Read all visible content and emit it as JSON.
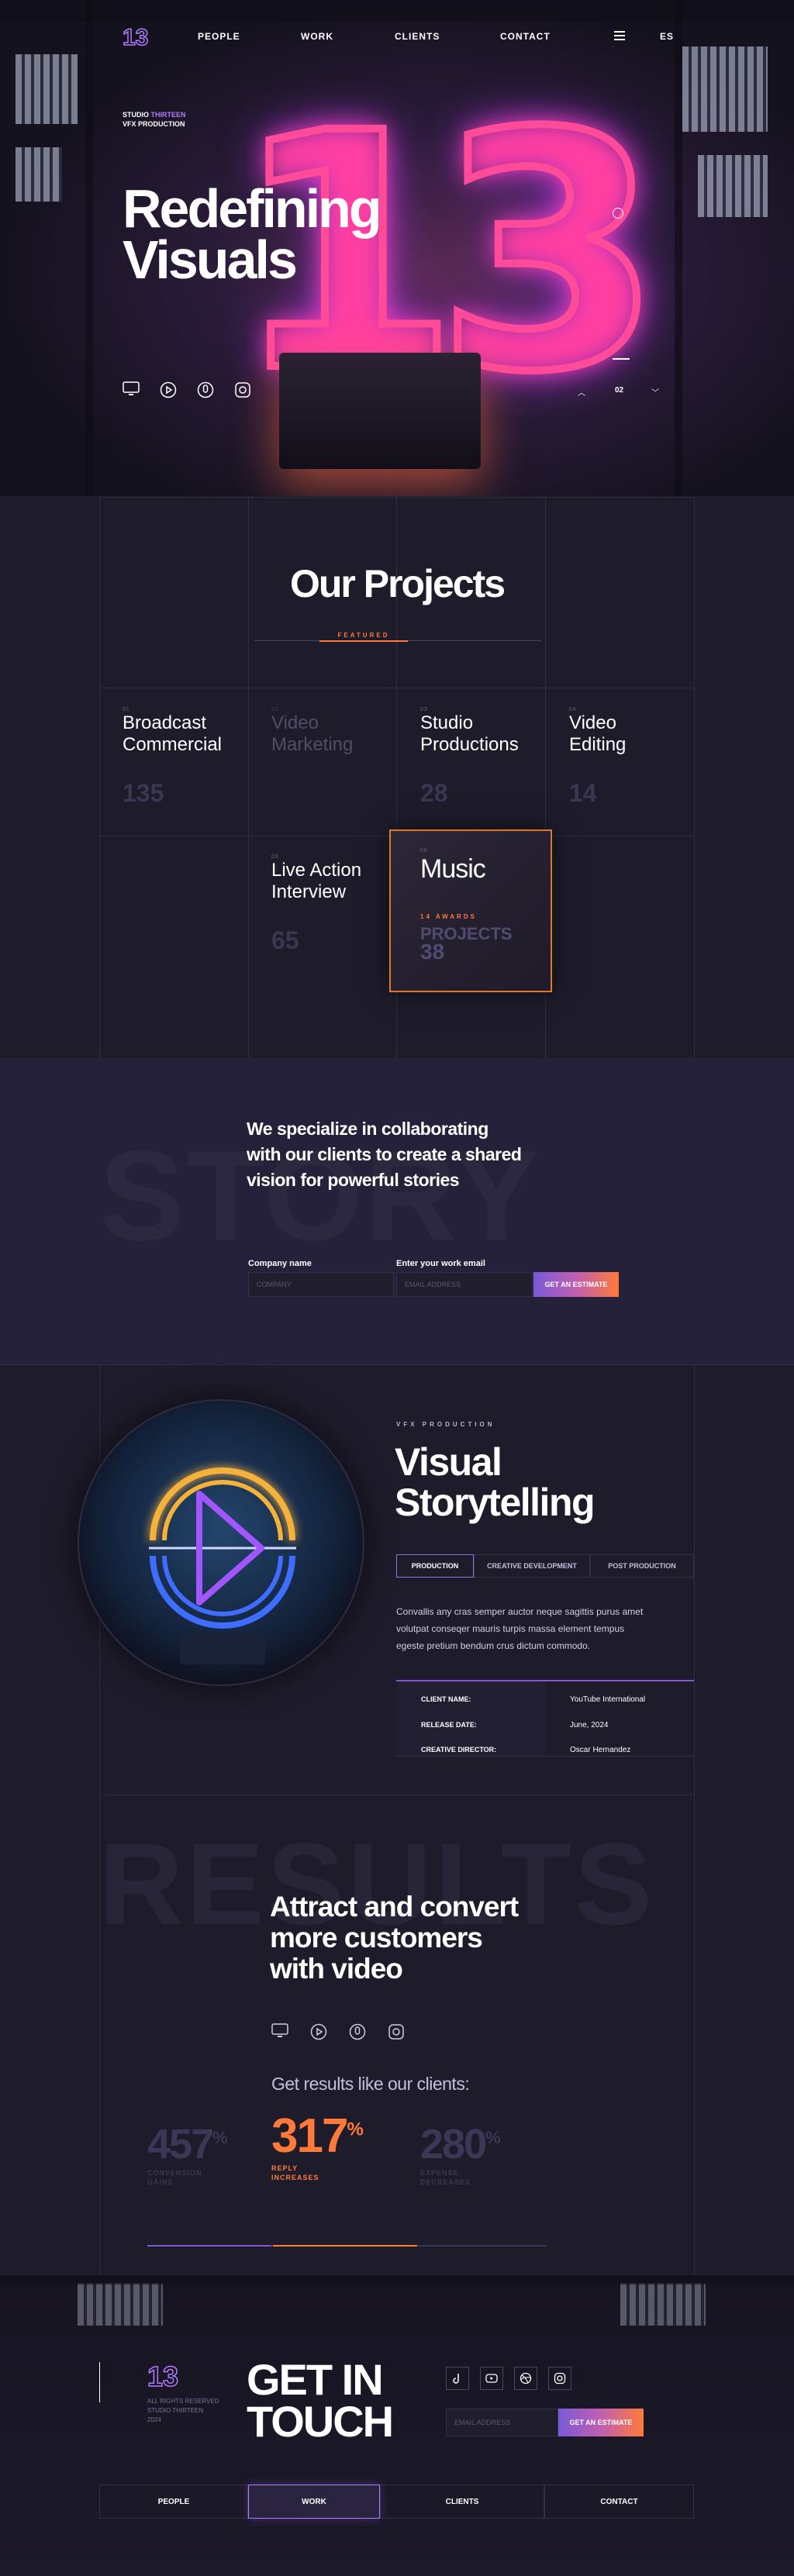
{
  "hero": {
    "logo": "13",
    "nav": [
      "PEOPLE",
      "WORK",
      "CLIENTS",
      "CONTACT"
    ],
    "lang": "ES",
    "studio_line1": "STUDIO",
    "studio_line1_accent": "THIRTEEN",
    "studio_line2": "VFX PRODUCTION",
    "title_line1": "Redefining",
    "title_line2": "Visuals",
    "slide": "02",
    "icons": [
      "monitor-icon",
      "play-icon",
      "mic-icon",
      "instagram-icon"
    ]
  },
  "projects": {
    "title": "Our Projects",
    "tab_label": "FEATURED",
    "items": [
      {
        "num": "01",
        "title_a": "Broadcast",
        "title_b": "Commercial",
        "count": "135"
      },
      {
        "num": "02",
        "title_a": "Video",
        "title_b": "Marketing",
        "count": ""
      },
      {
        "num": "03",
        "title_a": "Studio",
        "title_b": "Productions",
        "count": "28"
      },
      {
        "num": "04",
        "title_a": "Video",
        "title_b": "Editing",
        "count": "14"
      },
      {
        "num": "05",
        "title_a": "Live Action",
        "title_b": "Interview",
        "count": "65"
      }
    ],
    "featured": {
      "num": "06",
      "title": "Music",
      "awards": "14 AWARDS",
      "projects_label": "PROJECTS",
      "projects": "38"
    }
  },
  "story": {
    "ghost": "STORY",
    "headline_1": "We specialize in collaborating",
    "headline_2": "with our clients to create a shared",
    "headline_3": "vision for powerful stories",
    "company_label": "Company name",
    "company_placeholder": "COMPANY",
    "email_label": "Enter your work email",
    "email_placeholder": "EMAIL ADDRESS",
    "cta": "GET AN ESTIMATE"
  },
  "visual": {
    "kicker": "VFX PRODUCTION",
    "title_1": "Visual",
    "title_2": "Storytelling",
    "tabs": [
      "PRODUCTION",
      "CREATIVE DEVELOPMENT",
      "POST PRODUCTION"
    ],
    "body_1": "Convallis any cras semper auctor neque sagittis purus amet",
    "body_2": "volutpat conseqer mauris turpis massa element tempus",
    "body_3": "egeste pretium bendum crus dictum commodo.",
    "rows": [
      {
        "k": "CLIENT NAME:",
        "v": "YouTube International"
      },
      {
        "k": "RELEASE DATE:",
        "v": "June, 2024"
      },
      {
        "k": "CREATIVE DIRECTOR:",
        "v": "Oscar Hernandez"
      }
    ]
  },
  "results": {
    "ghost": "RESULTS",
    "headline_1": "Attract and convert",
    "headline_2": "more customers",
    "headline_3": "with video",
    "sub": "Get results like our clients:",
    "stats": [
      {
        "value": "457",
        "unit": "%",
        "l1": "CONVERSION",
        "l2": "GAINS"
      },
      {
        "value": "317",
        "unit": "%",
        "l1": "REPLY",
        "l2": "INCREASES"
      },
      {
        "value": "280",
        "unit": "%",
        "l1": "EXPENSE",
        "l2": "DECREASES"
      }
    ]
  },
  "contact": {
    "logo": "13",
    "rights_1": "ALL RIGHTS RESERVED",
    "rights_2": "STUDIO THIRTEEN",
    "rights_3": "2024",
    "title_1": "GET IN",
    "title_2": "TOUCH",
    "email_placeholder": "EMAIL ADDRESS",
    "cta": "GET AN ESTIMATE",
    "footer_nav": [
      "PEOPLE",
      "WORK",
      "CLIENTS",
      "CONTACT"
    ]
  },
  "colors": {
    "bg": "#1c1929",
    "accent_orange": "#ff7a3a",
    "accent_purple": "#7a5ad8",
    "neon_pink": "#ff4b9a"
  }
}
